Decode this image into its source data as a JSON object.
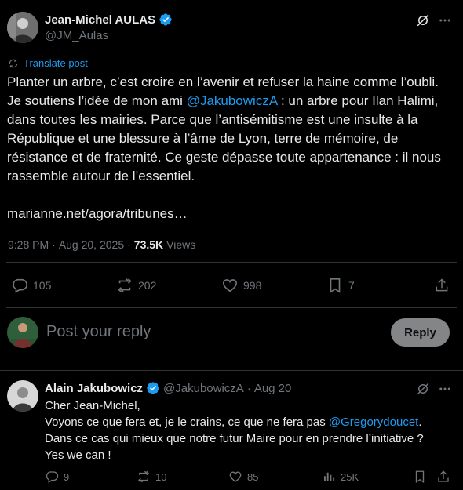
{
  "tweet": {
    "author_name": "Jean-Michel AULAS",
    "author_handle": "@JM_Aulas",
    "translate_label": "Translate post",
    "text_before_mention": "Planter un arbre, c’est croire en l’avenir et refuser la haine comme l’oubli. Je soutiens l’idée de mon ami ",
    "mention": "@JakubowiczA",
    "text_after_mention": " : un arbre pour Ilan Halimi, dans toutes les mairies. Parce que l’antisémitisme est une insulte à la République et une blessure à l’âme de Lyon, terre de mémoire, de résistance et de fraternité. Ce geste dépasse toute appartenance : il nous rassemble autour de l’essentiel.",
    "link": "marianne.net/agora/tribunes…",
    "time": "9:28 PM",
    "separator": "·",
    "date": "Aug 20, 2025",
    "views_count": "73.5K",
    "views_label": "Views",
    "replies": "105",
    "reposts": "202",
    "likes": "998",
    "bookmarks": "7"
  },
  "composer": {
    "placeholder": "Post your reply",
    "button_label": "Reply"
  },
  "reply": {
    "author_name": "Alain Jakubowicz",
    "author_handle": "@JakubowiczA",
    "separator": "·",
    "date": "Aug 20",
    "line1": "Cher Jean-Michel,",
    "line2_before": "Voyons ce que fera et, je le crains, ce que ne fera pas ",
    "line2_mention": "@Gregorydoucet",
    "line2_after": ".",
    "line3": "Dans ce cas qui mieux que notre futur Maire pour en prendre l’initiative ?",
    "line4": "Yes we can !",
    "replies": "9",
    "reposts": "10",
    "likes": "85",
    "views": "25K"
  },
  "colors": {
    "background": "#000000",
    "text": "#e7e9ea",
    "muted": "#71767b",
    "accent": "#1d9bf0",
    "divider": "#2f3336"
  },
  "icons": [
    "verified-badge-icon",
    "grok-icon",
    "more-icon",
    "translate-icon",
    "reply-icon",
    "repost-icon",
    "like-icon",
    "bookmark-icon",
    "views-icon",
    "share-icon"
  ]
}
